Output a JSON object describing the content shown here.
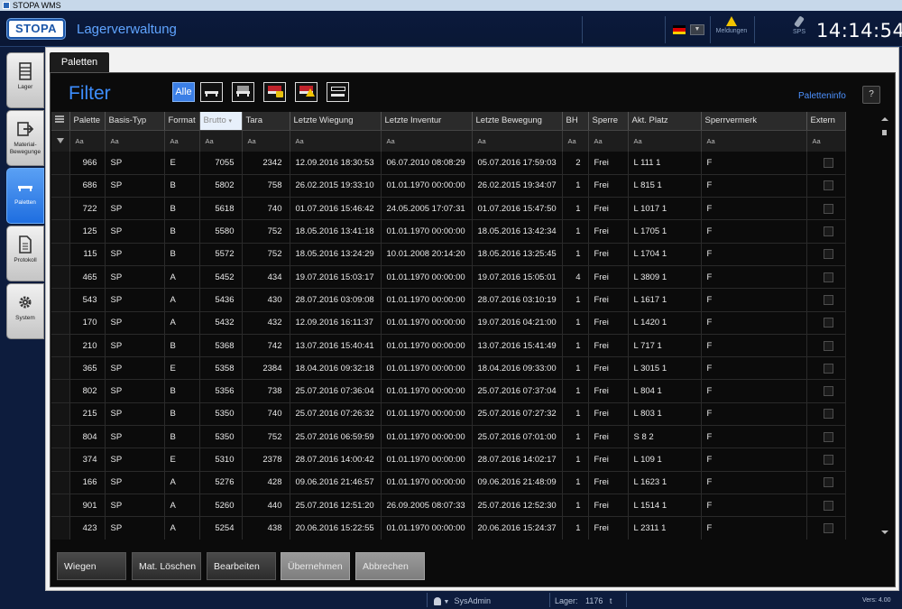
{
  "os_window_title": "STOPA WMS",
  "header": {
    "logo_text": "STOPA",
    "app_title": "Lagerverwaltung",
    "messages_label": "Meldungen",
    "sps_label": "SPS",
    "clock": "14:14:54"
  },
  "sidenav": [
    {
      "label": "Lager",
      "icon": "warehouse-icon",
      "active": false
    },
    {
      "label": "Material-\nBewegunge",
      "icon": "material-movement-icon",
      "active": false
    },
    {
      "label": "Paletten",
      "icon": "pallet-icon",
      "active": true
    },
    {
      "label": "Protokoll",
      "icon": "document-icon",
      "active": false
    },
    {
      "label": "System",
      "icon": "gear-icon",
      "active": false
    }
  ],
  "tab_label": "Paletten",
  "filter": {
    "title": "Filter",
    "all_label": "Alle",
    "paletteninfo_label": "Paletteninfo",
    "help_label": "?"
  },
  "grid": {
    "columns": [
      "Palette",
      "Basis-Typ",
      "Format",
      "Brutto",
      "Tara",
      "Letzte Wiegung",
      "Letzte Inventur",
      "Letzte Bewegung",
      "BH",
      "Sperre",
      "Akt. Platz",
      "Sperrvermerk",
      "Extern"
    ],
    "filter_placeholder": "Aa",
    "rows": [
      [
        "966",
        "SP",
        "E",
        "7055",
        "2342",
        "12.09.2016 18:30:53",
        "06.07.2010 08:08:29",
        "05.07.2016 17:59:03",
        "2",
        "Frei",
        "L 111 1",
        "F"
      ],
      [
        "686",
        "SP",
        "B",
        "5802",
        "758",
        "26.02.2015 19:33:10",
        "01.01.1970 00:00:00",
        "26.02.2015 19:34:07",
        "1",
        "Frei",
        "L 815 1",
        "F"
      ],
      [
        "722",
        "SP",
        "B",
        "5618",
        "740",
        "01.07.2016 15:46:42",
        "24.05.2005 17:07:31",
        "01.07.2016 15:47:50",
        "1",
        "Frei",
        "L 1017 1",
        "F"
      ],
      [
        "125",
        "SP",
        "B",
        "5580",
        "752",
        "18.05.2016 13:41:18",
        "01.01.1970 00:00:00",
        "18.05.2016 13:42:34",
        "1",
        "Frei",
        "L 1705 1",
        "F"
      ],
      [
        "115",
        "SP",
        "B",
        "5572",
        "752",
        "18.05.2016 13:24:29",
        "10.01.2008 20:14:20",
        "18.05.2016 13:25:45",
        "1",
        "Frei",
        "L 1704 1",
        "F"
      ],
      [
        "465",
        "SP",
        "A",
        "5452",
        "434",
        "19.07.2016 15:03:17",
        "01.01.1970 00:00:00",
        "19.07.2016 15:05:01",
        "4",
        "Frei",
        "L 3809 1",
        "F"
      ],
      [
        "543",
        "SP",
        "A",
        "5436",
        "430",
        "28.07.2016 03:09:08",
        "01.01.1970 00:00:00",
        "28.07.2016 03:10:19",
        "1",
        "Frei",
        "L 1617 1",
        "F"
      ],
      [
        "170",
        "SP",
        "A",
        "5432",
        "432",
        "12.09.2016 16:11:37",
        "01.01.1970 00:00:00",
        "19.07.2016 04:21:00",
        "1",
        "Frei",
        "L 1420 1",
        "F"
      ],
      [
        "210",
        "SP",
        "B",
        "5368",
        "742",
        "13.07.2016 15:40:41",
        "01.01.1970 00:00:00",
        "13.07.2016 15:41:49",
        "1",
        "Frei",
        "L 717 1",
        "F"
      ],
      [
        "365",
        "SP",
        "E",
        "5358",
        "2384",
        "18.04.2016 09:32:18",
        "01.01.1970 00:00:00",
        "18.04.2016 09:33:00",
        "1",
        "Frei",
        "L 3015 1",
        "F"
      ],
      [
        "802",
        "SP",
        "B",
        "5356",
        "738",
        "25.07.2016 07:36:04",
        "01.01.1970 00:00:00",
        "25.07.2016 07:37:04",
        "1",
        "Frei",
        "L 804 1",
        "F"
      ],
      [
        "215",
        "SP",
        "B",
        "5350",
        "740",
        "25.07.2016 07:26:32",
        "01.01.1970 00:00:00",
        "25.07.2016 07:27:32",
        "1",
        "Frei",
        "L 803 1",
        "F"
      ],
      [
        "804",
        "SP",
        "B",
        "5350",
        "752",
        "25.07.2016 06:59:59",
        "01.01.1970 00:00:00",
        "25.07.2016 07:01:00",
        "1",
        "Frei",
        "S 8 2",
        "F"
      ],
      [
        "374",
        "SP",
        "E",
        "5310",
        "2378",
        "28.07.2016 14:00:42",
        "01.01.1970 00:00:00",
        "28.07.2016 14:02:17",
        "1",
        "Frei",
        "L 109 1",
        "F"
      ],
      [
        "166",
        "SP",
        "A",
        "5276",
        "428",
        "09.06.2016 21:46:57",
        "01.01.1970 00:00:00",
        "09.06.2016 21:48:09",
        "1",
        "Frei",
        "L 1623 1",
        "F"
      ],
      [
        "901",
        "SP",
        "A",
        "5260",
        "440",
        "25.07.2016 12:51:20",
        "26.09.2005 08:07:33",
        "25.07.2016 12:52:30",
        "1",
        "Frei",
        "L 1514 1",
        "F"
      ],
      [
        "423",
        "SP",
        "A",
        "5254",
        "438",
        "20.06.2016 15:22:55",
        "01.01.1970 00:00:00",
        "20.06.2016 15:24:37",
        "1",
        "Frei",
        "L 2311 1",
        "F"
      ]
    ]
  },
  "actions": {
    "wiegen": "Wiegen",
    "mat_loeschen": "Mat. Löschen",
    "bearbeiten": "Bearbeiten",
    "uebernehmen": "Übernehmen",
    "abbrechen": "Abbrechen"
  },
  "statusbar": {
    "user": "SysAdmin",
    "lager_label": "Lager:",
    "lager_count": "1176",
    "lager_unit": "t",
    "version": "Vers: 4.00"
  },
  "colors": {
    "accent_blue": "#3d8eff",
    "nav_active": "#2f7ce8",
    "header_bg": "#0b1a3c"
  }
}
